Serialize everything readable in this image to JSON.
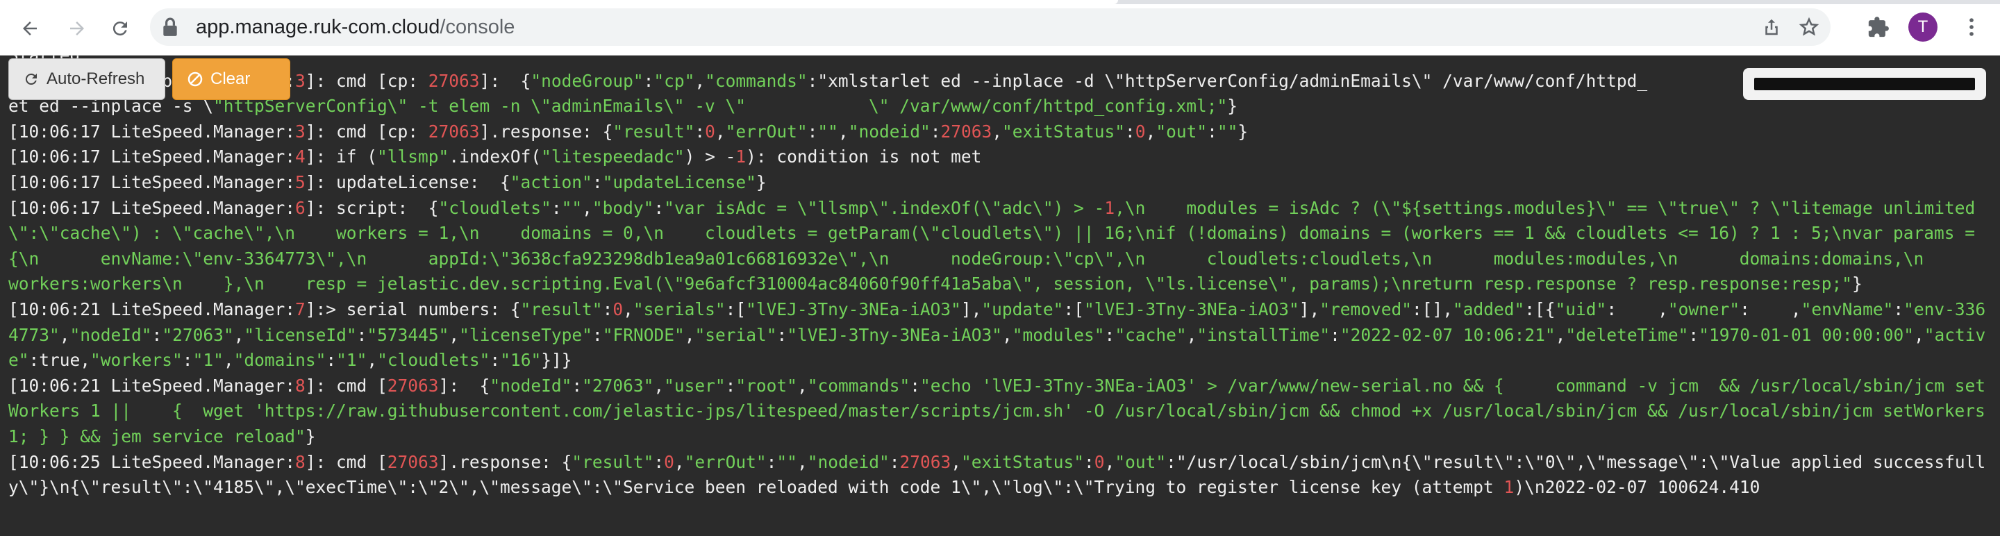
{
  "browser": {
    "url_host": "app.manage.ruk-com.cloud",
    "url_path": "/console",
    "avatar_letter": "T"
  },
  "toolbar": {
    "refresh_label": "Auto-Refresh",
    "clear_label": "Clear"
  },
  "colors": {
    "accent_clear": "#f0a23a",
    "log_key": "#72d15a",
    "log_number": "#e05555"
  },
  "log": [
    "Started ...",
    "[10:06:17 LiteSpeed.Manager:3]: cmd [cp: 27063]:  {\"nodeGroup\":\"cp\",\"commands\":\"xmlstarlet ed --inplace -d \\\"httpServerConfig/adminEmails\\\" /var/www/conf/httpd_",
    "et ed --inplace -s \\\"httpServerConfig\\\" -t elem -n \\\"adminEmails\\\" -v \\\"            \\\" /var/www/conf/httpd_config.xml;\"}",
    "[10:06:17 LiteSpeed.Manager:3]: cmd [cp: 27063].response: {\"result\":0,\"errOut\":\"\",\"nodeid\":27063,\"exitStatus\":0,\"out\":\"\"}",
    "[10:06:17 LiteSpeed.Manager:4]: if (\"llsmp\".indexOf(\"litespeedadc\") > -1): condition is not met",
    "[10:06:17 LiteSpeed.Manager:5]: updateLicense:  {\"action\":\"updateLicense\"}",
    "[10:06:17 LiteSpeed.Manager:6]: script:  {\"cloudlets\":\"\",\"body\":\"var isAdc = \\\"llsmp\\\".indexOf(\\\"adc\\\") > -1,\\n    modules = isAdc ? (\\\"${settings.modules}\\\" == \\\"true\\\" ? \\\"litemage unlimited\\\":\\\"cache\\\") : \\\"cache\\\",\\n    workers = 1,\\n    domains = 0,\\n    cloudlets = getParam(\\\"cloudlets\\\") || 16;\\nif (!domains) domains = (workers == 1 && cloudlets <= 16) ? 1 : 5;\\nvar params = {\\n      envName:\\\"env-3364773\\\",\\n      appId:\\\"3638cfa923298db1ea9a01c66816932e\\\",\\n      nodeGroup:\\\"cp\\\",\\n      cloudlets:cloudlets,\\n      modules:modules,\\n      domains:domains,\\n      workers:workers\\n    },\\n    resp = jelastic.dev.scripting.Eval(\\\"9e6afcf310004ac84060f90ff41a5aba\\\", session, \\\"ls.license\\\", params);\\nreturn resp.response ? resp.response:resp;\"}",
    "[10:06:21 LiteSpeed.Manager:7]:> serial numbers: {\"result\":0,\"serials\":[\"lVEJ-3Tny-3NEa-iAO3\"],\"update\":[\"lVEJ-3Tny-3NEa-iAO3\"],\"removed\":[],\"added\":[{\"uid\":    ,\"owner\":    ,\"envName\":\"env-3364773\",\"nodeId\":\"27063\",\"licenseId\":\"573445\",\"licenseType\":\"FRNODE\",\"serial\":\"lVEJ-3Tny-3NEa-iAO3\",\"modules\":\"cache\",\"installTime\":\"2022-02-07 10:06:21\",\"deleteTime\":\"1970-01-01 00:00:00\",\"active\":true,\"workers\":\"1\",\"domains\":\"1\",\"cloudlets\":\"16\"}]}",
    "[10:06:21 LiteSpeed.Manager:8]: cmd [27063]:  {\"nodeId\":\"27063\",\"user\":\"root\",\"commands\":\"echo 'lVEJ-3Tny-3NEa-iAO3' > /var/www/new-serial.no && {     command -v jcm  && /usr/local/sbin/jcm setWorkers 1 ||    {  wget 'https://raw.githubusercontent.com/jelastic-jps/litespeed/master/scripts/jcm.sh' -O /usr/local/sbin/jcm && chmod +x /usr/local/sbin/jcm && /usr/local/sbin/jcm setWorkers 1; } } && jem service reload\"}",
    "[10:06:25 LiteSpeed.Manager:8]: cmd [27063].response: {\"result\":0,\"errOut\":\"\",\"nodeid\":27063,\"exitStatus\":0,\"out\":\"/usr/local/sbin/jcm\\n{\\\"result\\\":\\\"0\\\",\\\"message\\\":\\\"Value applied successfully\\\"}\\n{\\\"result\\\":\\\"4185\\\",\\\"execTime\\\":\\\"2\\\",\\\"message\\\":\\\"Service been reloaded with code 1\\\",\\\"log\\\":\\\"Trying to register license key (attempt 1)\\n2022-02-07 100624.410"
  ]
}
